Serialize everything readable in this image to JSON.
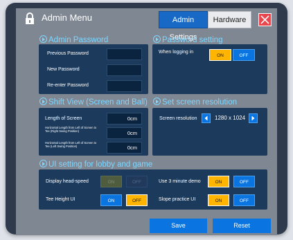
{
  "window": {
    "title": "Admin Menu"
  },
  "tabs": [
    {
      "label": "Admin Settings",
      "active": true
    },
    {
      "label": "Hardware",
      "active": false
    }
  ],
  "close_icon": "close-icon",
  "admin_password": {
    "title": "Admin Password",
    "previous_label": "Previous Password",
    "new_label": "New Password",
    "reenter_label": "Re-enter Password",
    "previous_value": "",
    "new_value": "",
    "reenter_value": ""
  },
  "password_setting": {
    "title": "Password setting",
    "when_logging_in_label": "When logging in",
    "on_label": "ON",
    "off_label": "OFF",
    "selected": "ON"
  },
  "shift_view": {
    "title": "Shift View (Screen and Ball)",
    "length_label": "Length of Screen",
    "length_value": "0cm",
    "right_swing_label": "Horizontal Length from Left of Screen to Tee (Right Swing Position)",
    "right_swing_value": "0cm",
    "left_swing_label": "Horizontal Length from Left of Screen to Tee (Left Swing Position)",
    "left_swing_value": "0cm"
  },
  "screen_resolution": {
    "title": "Set screen resolution",
    "label": "Screen resolution",
    "value": "1280 x 1024"
  },
  "ui_setting": {
    "title": "UI setting for lobby and game",
    "display_head_speed": {
      "label": "Display head-speed",
      "on_label": "ON",
      "off_label": "OFF",
      "enabled": false
    },
    "tee_height": {
      "label": "Tee Height UI",
      "on_label": "ON",
      "off_label": "OFF",
      "selected": "OFF"
    },
    "three_minute_demo": {
      "label": "Use 3 minute demo",
      "on_label": "ON",
      "off_label": "OFF",
      "selected": "ON"
    },
    "slope_practice": {
      "label": "Slope practice UI",
      "on_label": "ON",
      "off_label": "OFF",
      "selected": "ON"
    }
  },
  "footer": {
    "save_label": "Save",
    "reset_label": "Reset"
  },
  "colors": {
    "accent_blue": "#0a74e0",
    "on_yellow": "#ffb400",
    "section_title": "#7fd6ff",
    "close_red": "#e8474d"
  }
}
